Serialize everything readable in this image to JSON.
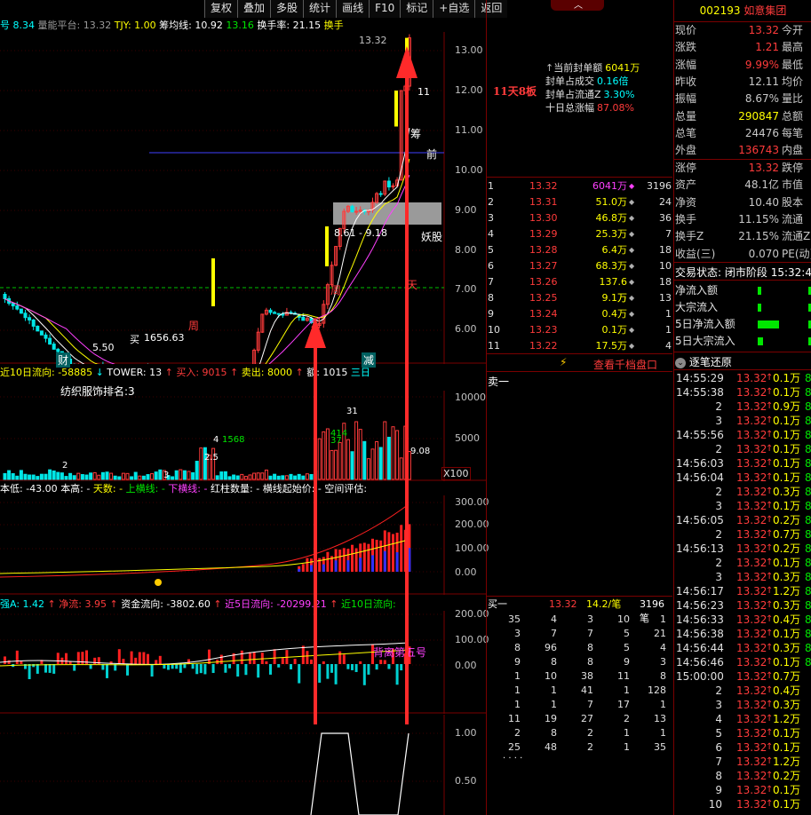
{
  "toolbar": [
    "复权",
    "叠加",
    "多股",
    "统计",
    "画线",
    "F10",
    "标记",
    "+自选",
    "返回"
  ],
  "header": {
    "ind1_label": "量能平台:",
    "ind1_val": "13.32",
    "tjy_label": "TJY:",
    "tjy_val": "1.00",
    "cjx_label": "筹均线:",
    "cjx_val": "10.92",
    "cjx_val2": "13.16",
    "hsl_label": "换手率:",
    "hsl_val": "21.15",
    "hs_short": "换手",
    "left_cut": "号",
    "left_cut_val": "8.34"
  },
  "price_axis": [
    "13.00",
    "12.00",
    "11.00",
    "10.00",
    "9.00",
    "8.00",
    "7.00",
    "6.00"
  ],
  "main_annotations": {
    "high": "13.32",
    "low": "5.50",
    "buy_label": "买",
    "buy_price": "1656.63",
    "range": "8.61 - 9.18",
    "yao": "妖股",
    "week1": "周",
    "week2": "周",
    "month": "月",
    "chou": "筹",
    "qian": "前",
    "eleven": "11",
    "cai": "财",
    "jian": "减",
    "tian": "天"
  },
  "seal_info": {
    "streak": "11天8板",
    "lines": [
      {
        "label": "当前封单额",
        "value": "6041万"
      },
      {
        "label": "封单占成交",
        "value": "0.16倍"
      },
      {
        "label": "封单占流通Z",
        "value": "3.30%"
      },
      {
        "label": "十日总涨幅",
        "value": "87.08%"
      }
    ]
  },
  "vol_header": {
    "fund10_label": "近10日流向:",
    "fund10_val": "-58885",
    "tower_label": "TOWER:",
    "tower_val": "13",
    "buy_label": "买入:",
    "buy_val": "9015",
    "sell_label": "卖出:",
    "sell_val": "8000",
    "amount_label": "额:",
    "amount_val": "1015",
    "three_label": "三日",
    "sector": "纺织服饰排名:3",
    "x100": "X100",
    "axis": [
      "10000",
      "5000"
    ],
    "v2": "2",
    "v1568": "1568",
    "v414": "414",
    "v37": "37",
    "v31": "31",
    "v908": "9.08",
    "v4": "4",
    "v3": "3",
    "v25": "2.5"
  },
  "ind2_header": {
    "low_label": "本低:",
    "low_val": "-43.00",
    "high_label": "本高:",
    "high_val": "-",
    "days_label": "天数:",
    "days_val": "-",
    "up_label": "上横线:",
    "up_val": "-",
    "down_label": "下横线:",
    "down_val": "-",
    "red_label": "红柱数量:",
    "red_val": "-",
    "start_label": "横线起始价:",
    "start_val": "-",
    "space_label": "空间评估:",
    "axis": [
      "300.00",
      "200.00",
      "100.00",
      "0.00"
    ]
  },
  "ind3_header": {
    "a_label": "强A:",
    "a_val": "1.42",
    "jl_label": "净流:",
    "jl_val": "3.95",
    "zj_label": "资金流向:",
    "zj_val": "-3802.60",
    "d5_label": "近5日流向:",
    "d5_val": "-20299.21",
    "d10_label": "近10日流向:",
    "annot": "背离第五号",
    "axis": [
      "200.00",
      "100.00",
      "0.00"
    ]
  },
  "ind4_axis": [
    "1.00",
    "0.50"
  ],
  "stock": {
    "code": "002193",
    "name": "如意集团"
  },
  "quote_left": [
    {
      "l": "现价",
      "v": "13.32",
      "c": "#ff3b3b",
      "r": "今开"
    },
    {
      "l": "涨跌",
      "v": "1.21",
      "c": "#ff3b3b",
      "r": "最高"
    },
    {
      "l": "涨幅",
      "v": "9.99%",
      "c": "#ff3b3b",
      "r": "最低"
    },
    {
      "l": "昨收",
      "v": "12.11",
      "c": "#c8c8c8",
      "r": "均价"
    },
    {
      "l": "振幅",
      "v": "8.67%",
      "c": "#c8c8c8",
      "r": "量比"
    },
    {
      "l": "总量",
      "v": "290847",
      "c": "#ffff00",
      "r": "总额"
    },
    {
      "l": "总笔",
      "v": "24476",
      "c": "#c8c8c8",
      "r": "每笔"
    },
    {
      "l": "外盘",
      "v": "136743",
      "c": "#ff3b3b",
      "r": "内盘"
    }
  ],
  "quote_left2": [
    {
      "l": "涨停",
      "v": "13.32",
      "c": "#ff3b3b",
      "r": "跌停"
    },
    {
      "l": "资产",
      "v": "48.1亿",
      "c": "#c8c8c8",
      "r": "市值"
    },
    {
      "l": "净资",
      "v": "10.40",
      "c": "#c8c8c8",
      "r": "股本"
    },
    {
      "l": "换手",
      "v": "11.15%",
      "c": "#c8c8c8",
      "r": "流通"
    },
    {
      "l": "换手Z",
      "v": "21.15%",
      "c": "#c8c8c8",
      "r": "流通Z"
    },
    {
      "l": "收益(三)",
      "v": "0.070",
      "c": "#c8c8c8",
      "r": "PE(动)"
    }
  ],
  "trade_state": {
    "label": "交易状态:",
    "value": "闭市阶段",
    "time": "15:32:4"
  },
  "fund_flows": [
    "净流入额",
    "大宗流入",
    "5日净流入额",
    "5日大宗流入"
  ],
  "orderbook": [
    {
      "n": "1",
      "p": "13.32",
      "v": "6041万",
      "q": "3196"
    },
    {
      "n": "2",
      "p": "13.31",
      "v": "51.0万",
      "q": "24"
    },
    {
      "n": "3",
      "p": "13.30",
      "v": "46.8万",
      "q": "36"
    },
    {
      "n": "4",
      "p": "13.29",
      "v": "25.3万",
      "q": "7"
    },
    {
      "n": "5",
      "p": "13.28",
      "v": "6.4万",
      "q": "18"
    },
    {
      "n": "6",
      "p": "13.27",
      "v": "68.3万",
      "q": "10"
    },
    {
      "n": "7",
      "p": "13.26",
      "v": "137.6万",
      "q": "18"
    },
    {
      "n": "8",
      "p": "13.25",
      "v": "9.1万",
      "q": "13"
    },
    {
      "n": "9",
      "p": "13.24",
      "v": "0.4万",
      "q": "1"
    },
    {
      "n": "10",
      "p": "13.23",
      "v": "0.1万",
      "q": "1"
    },
    {
      "n": "11",
      "p": "13.22",
      "v": "17.5万",
      "q": "4"
    }
  ],
  "view_orderbook": "查看千档盘口",
  "sell1": "卖一",
  "buy1": {
    "label": "买一",
    "price": "13.32",
    "per": "14.2/笔",
    "q": "3196笔"
  },
  "buy_queue": [
    [
      "35",
      "4",
      "3",
      "10",
      "1"
    ],
    [
      "3",
      "7",
      "7",
      "5",
      "21"
    ],
    [
      "8",
      "96",
      "8",
      "5",
      "4"
    ],
    [
      "9",
      "8",
      "8",
      "9",
      "3"
    ],
    [
      "1",
      "10",
      "38",
      "11",
      "8"
    ],
    [
      "1",
      "1",
      "41",
      "1",
      "128"
    ],
    [
      "1",
      "1",
      "7",
      "17",
      "1"
    ],
    [
      "11",
      "19",
      "27",
      "2",
      "13"
    ],
    [
      "2",
      "8",
      "2",
      "1",
      "1"
    ],
    [
      "25",
      "48",
      "2",
      "1",
      "35"
    ]
  ],
  "queue_more": ". . . .",
  "tick_title": "逐笔还原",
  "ticks": [
    {
      "t": "14:55:29",
      "p": "13.32",
      "v": "0.1万",
      "s": "8"
    },
    {
      "t": "14:55:38",
      "p": "13.32",
      "v": "0.1万",
      "s": "8"
    },
    {
      "t": "2",
      "p": "13.32",
      "v": "0.9万",
      "s": "8"
    },
    {
      "t": "3",
      "p": "13.32",
      "v": "0.1万",
      "s": "8"
    },
    {
      "t": "14:55:56",
      "p": "13.32",
      "v": "0.1万",
      "s": "8"
    },
    {
      "t": "2",
      "p": "13.32",
      "v": "0.1万",
      "s": "8"
    },
    {
      "t": "14:56:03",
      "p": "13.32",
      "v": "0.1万",
      "s": "8"
    },
    {
      "t": "14:56:04",
      "p": "13.32",
      "v": "0.1万",
      "s": "8"
    },
    {
      "t": "2",
      "p": "13.32",
      "v": "0.3万",
      "s": "8"
    },
    {
      "t": "3",
      "p": "13.32",
      "v": "0.1万",
      "s": "8"
    },
    {
      "t": "14:56:05",
      "p": "13.32",
      "v": "0.2万",
      "s": "8"
    },
    {
      "t": "2",
      "p": "13.32",
      "v": "0.7万",
      "s": "8"
    },
    {
      "t": "14:56:13",
      "p": "13.32",
      "v": "0.2万",
      "s": "8"
    },
    {
      "t": "2",
      "p": "13.32",
      "v": "0.1万",
      "s": "8"
    },
    {
      "t": "3",
      "p": "13.32",
      "v": "0.3万",
      "s": "8"
    },
    {
      "t": "14:56:17",
      "p": "13.32",
      "v": "1.2万",
      "s": "8"
    },
    {
      "t": "14:56:23",
      "p": "13.32",
      "v": "0.3万",
      "s": "8"
    },
    {
      "t": "14:56:33",
      "p": "13.32",
      "v": "0.4万",
      "s": "8"
    },
    {
      "t": "14:56:38",
      "p": "13.32",
      "v": "0.1万",
      "s": "8"
    },
    {
      "t": "14:56:44",
      "p": "13.32",
      "v": "0.3万",
      "s": "8"
    },
    {
      "t": "14:56:46",
      "p": "13.32",
      "v": "0.1万",
      "s": "8"
    },
    {
      "t": "15:00:00",
      "p": "13.32",
      "v": "0.7万",
      "s": ""
    },
    {
      "t": "2",
      "p": "13.32",
      "v": "0.4万",
      "s": ""
    },
    {
      "t": "3",
      "p": "13.32",
      "v": "0.3万",
      "s": ""
    },
    {
      "t": "4",
      "p": "13.32",
      "v": "1.2万",
      "s": ""
    },
    {
      "t": "5",
      "p": "13.32",
      "v": "0.1万",
      "s": ""
    },
    {
      "t": "6",
      "p": "13.32",
      "v": "0.1万",
      "s": ""
    },
    {
      "t": "7",
      "p": "13.32",
      "v": "1.2万",
      "s": ""
    },
    {
      "t": "8",
      "p": "13.32",
      "v": "0.2万",
      "s": ""
    },
    {
      "t": "9",
      "p": "13.32",
      "v": "0.1万",
      "s": ""
    },
    {
      "t": "10",
      "p": "13.32",
      "v": "0.1万",
      "s": ""
    }
  ]
}
